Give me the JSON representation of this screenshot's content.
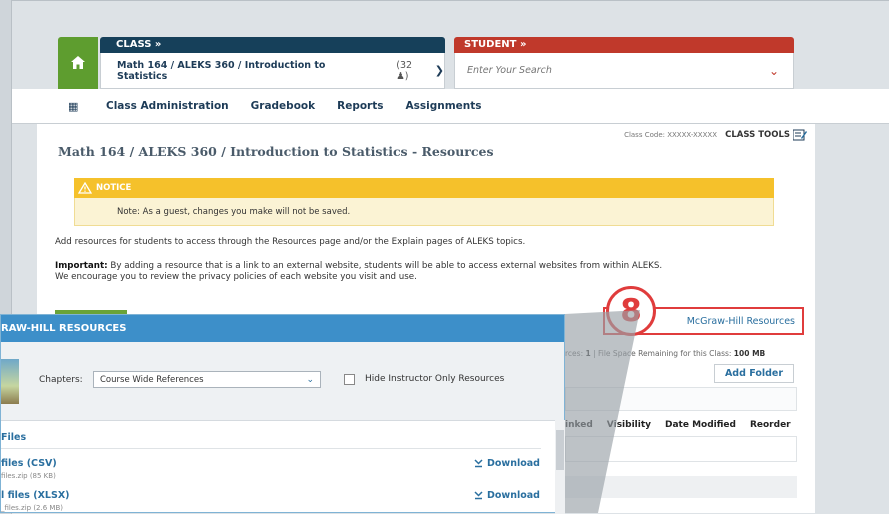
{
  "header": {
    "class_label": "CLASS »",
    "class_name": "Math 164 / ALEKS 360 / Introduction to Statistics",
    "class_count": "(32",
    "student_label": "STUDENT »",
    "student_placeholder": "Enter Your Search"
  },
  "nav": {
    "items": [
      "Class Administration",
      "Gradebook",
      "Reports",
      "Assignments"
    ]
  },
  "page": {
    "class_code": "Class Code: XXXXX-XXXXX",
    "class_tools": "CLASS TOOLS",
    "title": "Math 164 / ALEKS 360 / Introduction to Statistics - Resources",
    "notice_title": "NOTICE",
    "notice_text": "Note: As a guest, changes you make will not be saved.",
    "intro": "Add resources for students to access through the Resources page and/or the Explain pages of ALEKS topics.",
    "important_label": "Important:",
    "important_line1": " By adding a resource that is a link to an external website, students will be able to access external websites from within ALEKS.",
    "important_line2": "We encourage you to review the privacy policies of each website you visit and use.",
    "mh_link": "McGraw-Hill Resources",
    "callout_number": "8",
    "file_info_prefix": "rces: ",
    "file_info_count": "1",
    "file_info_middle": " | File Space Remaining for this Class: ",
    "file_info_space": "100 MB",
    "add_folder": "Add Folder",
    "columns": [
      "inked",
      "Visibility",
      "Date Modified",
      "Reorder"
    ]
  },
  "popup": {
    "title": "RAW-HILL RESOURCES",
    "chapters_label": "Chapters:",
    "chapters_value": "Course Wide References",
    "hide_label": "Hide Instructor Only Resources",
    "section": "Files",
    "files": [
      {
        "name": "files (CSV)",
        "sub": "files.zip (85 KB)",
        "action": "Download"
      },
      {
        "name": "l files (XLSX)",
        "sub": "_files.zip (2.6 MB)",
        "action": "Download"
      }
    ]
  },
  "colors": {
    "class_header": "#16405a",
    "student_header": "#c0392b",
    "home": "#5e9d2f",
    "notice": "#f5c12b",
    "link": "#2a6f9f",
    "highlight": "#e03c3c",
    "popup_header": "#3d8fc9"
  },
  "icons": [
    "home-icon",
    "user-icon",
    "chevron-down-icon",
    "grid-icon",
    "edit-icon",
    "warning-icon",
    "download-icon"
  ]
}
